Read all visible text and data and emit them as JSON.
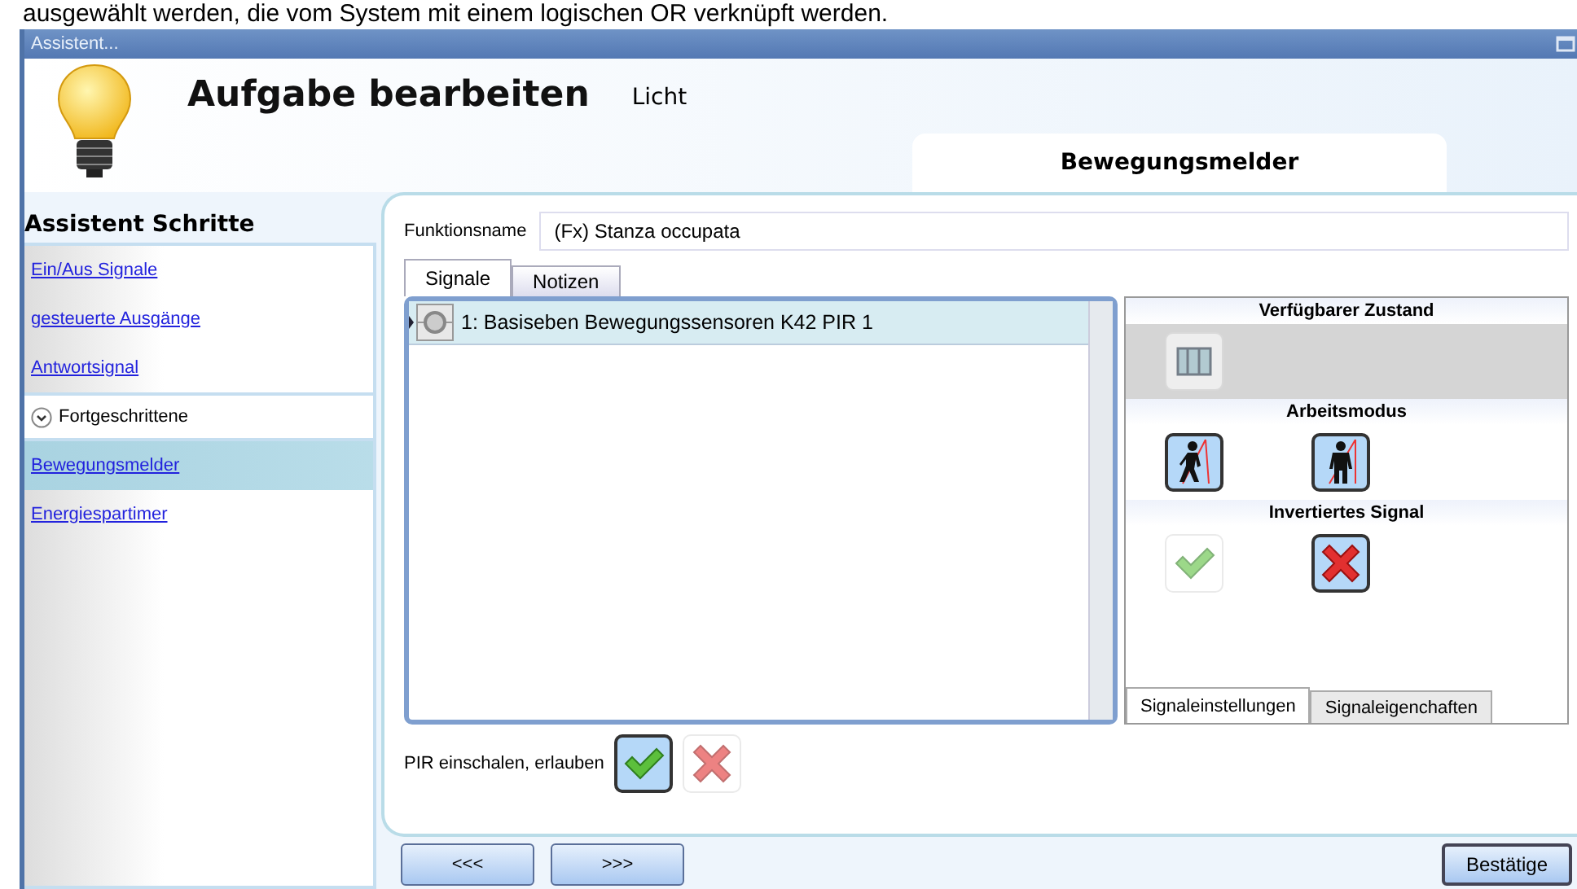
{
  "caption": "ausgewählt werden, die vom System mit einem logischen OR verknüpft werden.",
  "window": {
    "title": "Assistent..."
  },
  "header": {
    "title": "Aufgabe bearbeiten",
    "subtitle": "Licht",
    "page_tab": "Bewegungsmelder"
  },
  "sidebar": {
    "title": "Assistent Schritte",
    "items": [
      {
        "kind": "link",
        "label": "Ein/Aus Signale",
        "selected": false
      },
      {
        "kind": "link",
        "label": "gesteuerte Ausgänge",
        "selected": false
      },
      {
        "kind": "link",
        "label": "Antwortsignal",
        "selected": false
      },
      {
        "kind": "group",
        "label": "Fortgeschrittene",
        "expanded": true
      },
      {
        "kind": "link",
        "label": "Bewegungsmelder",
        "selected": true
      },
      {
        "kind": "link",
        "label": "Energiespartimer",
        "selected": false
      }
    ]
  },
  "function_name": {
    "label": "Funktionsname",
    "value": "(Fx) Stanza occupata"
  },
  "tabs": [
    {
      "label": "Signale",
      "selected": true
    },
    {
      "label": "Notizen",
      "selected": false
    }
  ],
  "signals": [
    {
      "label": "1: Basiseben Bewegungssensoren K42 PIR 1",
      "selected": true
    }
  ],
  "settings": {
    "sections": [
      {
        "title": "Verfügbarer Zustand",
        "options": [
          {
            "kind": "door",
            "selected": false
          }
        ]
      },
      {
        "title": "Arbeitsmodus",
        "options": [
          {
            "kind": "walk",
            "selected": true
          },
          {
            "kind": "stand",
            "selected": true
          }
        ]
      },
      {
        "title": "Invertiertes Signal",
        "options": [
          {
            "kind": "check",
            "selected": false
          },
          {
            "kind": "cross",
            "selected": true
          }
        ]
      }
    ],
    "tabs": [
      {
        "label": "Signaleinstellungen",
        "selected": true
      },
      {
        "label": "Signaleigenchaften",
        "selected": false
      }
    ]
  },
  "pir": {
    "label": "PIR einschalen, erlauben",
    "options": [
      {
        "kind": "check",
        "selected": true
      },
      {
        "kind": "cross",
        "selected": false
      }
    ]
  },
  "nav_buttons": [
    "<<<",
    ">>>"
  ],
  "confirm": "Bestätige"
}
